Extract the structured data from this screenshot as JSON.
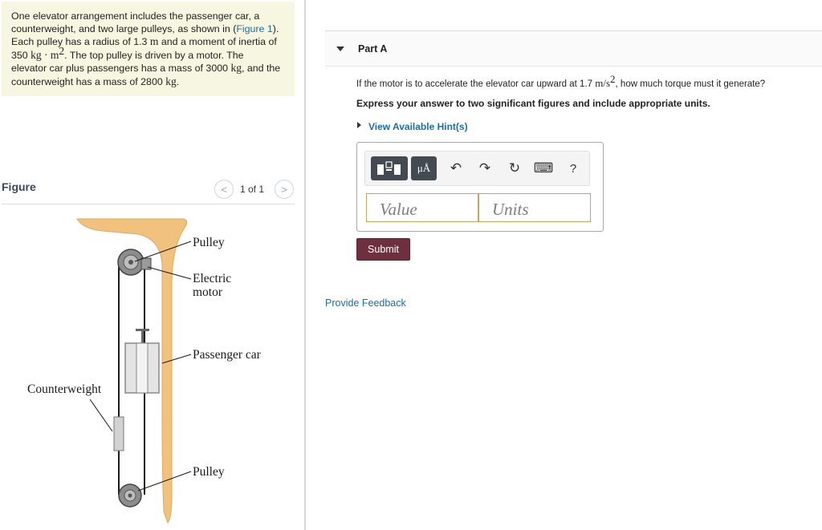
{
  "problem": {
    "t1": "One elevator arrangement includes the passenger car, a",
    "t2": "counterweight, and two large pulleys, as shown in (",
    "figure_link": "Figure 1",
    "t2_end": ").",
    "t3a": "Each pulley has a radius of 1.3",
    "t3_unit": "m",
    "t3b": "and a moment of inertia of",
    "t4_val": "350",
    "t4_unit": "kg · m",
    "t4_exp": "2",
    "t4b": ". The top pulley is driven by a motor. The",
    "t5a": "elevator car plus passengers has a mass of 3000",
    "t5_unit": "kg",
    "t5b": ", and the",
    "t6a": "counterweight has a mass of 2800",
    "t6_unit": "kg",
    "t6b": "."
  },
  "figure": {
    "title": "Figure",
    "prev_icon": "chevron-left-icon",
    "next_icon": "chevron-right-icon",
    "prev_glyph": "<",
    "next_glyph": ">",
    "counter": "1 of 1",
    "labels": {
      "pulley_top": "Pulley",
      "motor_line1": "Electric",
      "motor_line2": "motor",
      "passenger_car": "Passenger car",
      "counterweight": "Counterweight",
      "pulley_bottom": "Pulley"
    },
    "colors": {
      "beam": "#f1c27d",
      "beam_edge": "#e0a85a",
      "cable": "#1a1a1a",
      "pulley": "#8c8c8c",
      "car": "#e4e4e4"
    }
  },
  "part": {
    "title": "Part A",
    "question_pre": "If the motor is to accelerate the elevator car upward at 1.7",
    "question_unit": "m/s",
    "question_exp": "2",
    "question_post": ", how much torque must it generate?",
    "instruction": "Express your answer to two significant figures and include appropriate units.",
    "hint_link": "View Available Hint(s)"
  },
  "toolbar": {
    "units_label": "μÅ",
    "undo_glyph": "↶",
    "redo_glyph": "↷",
    "reset_glyph": "↻",
    "keyboard_glyph": "⌨",
    "help_glyph": "?",
    "icons": [
      "templates-icon",
      "units-icon",
      "undo-icon",
      "redo-icon",
      "reset-icon",
      "keyboard-icon",
      "help-icon"
    ]
  },
  "answer": {
    "value_placeholder": "Value",
    "units_placeholder": "Units",
    "value": "",
    "units": ""
  },
  "submit_label": "Submit",
  "feedback_link": "Provide Feedback",
  "colors": {
    "problem_bg": "#f7f6e0",
    "link": "#1a6fa8",
    "submit_bg": "#6e2f3e",
    "toolbar_dark": "#444a52",
    "field_border": "#c9a35a"
  }
}
